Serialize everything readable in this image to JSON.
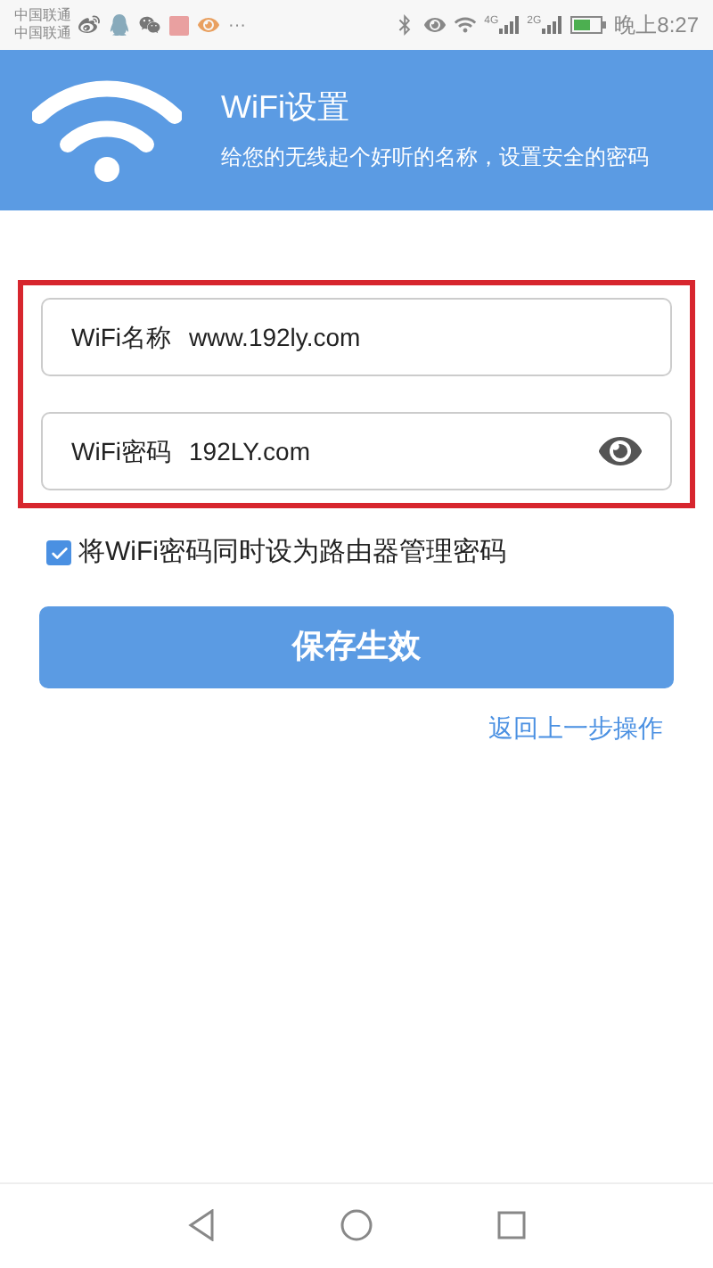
{
  "status_bar": {
    "carriers": [
      "中国联通",
      "中国联通"
    ],
    "more": "···",
    "network_labels": [
      "4G",
      "2G"
    ],
    "time": "晚上8:27"
  },
  "header": {
    "title": "WiFi设置",
    "subtitle": "给您的无线起个好听的名称，设置安全的密码"
  },
  "fields": [
    {
      "kind": "text",
      "label": "WiFi名称",
      "value": "www.192ly.com"
    },
    {
      "kind": "password",
      "label": "WiFi密码",
      "value": "192LY.com"
    }
  ],
  "sync_option": {
    "label": "将WiFi密码同时设为路由器管理密码",
    "checked": true
  },
  "save_button": "保存生效",
  "back_link": "返回上一步操作"
}
